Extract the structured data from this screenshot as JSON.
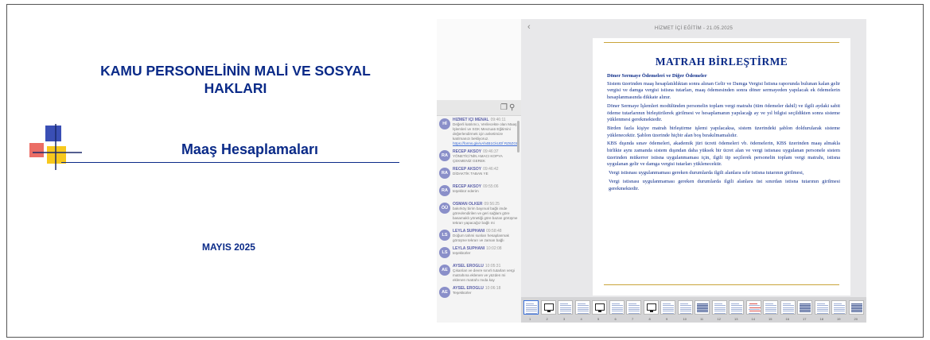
{
  "slide": {
    "title": "KAMU PERSONELİNİN  MALİ VE SOSYAL HAKLARI",
    "subtitle": "Maaş Hesaplamaları",
    "date_month": "MAYIS",
    "date_year": "2025",
    "colors": {
      "title": "#0a2a88",
      "deco_blue": "#3a4fb5",
      "deco_yellow": "#f7c81d",
      "deco_red": "#e8544a"
    }
  },
  "screenshot": {
    "header": "HİZMET İÇİ EĞİTİM - 21.05.2025",
    "back_icon": "chevron-left-icon",
    "chat": {
      "toolbar_icons": [
        "copy-icon",
        "search-icon"
      ],
      "messages": [
        {
          "initials": "Hİ",
          "name": "HİZMET İÇİ MENAL",
          "time": "09:46:11",
          "text": "Değerli katılımcı, Verilecekte olan Maaş İşlemleri ve SGK Mevzuatı Eğitimini değerlendirmek için anketimize katılmanızı bekliyoruz.",
          "link": "https://forms.gle/xAh4B1CkUDf RZ6ZG8"
        },
        {
          "initials": "RA",
          "name": "RECEP AKSOY",
          "time": "09:46:37",
          "text": "YÖNETİCİ'NİN AMACI KOPYA ÇEKMENİZ GEREK"
        },
        {
          "initials": "RA",
          "name": "RECEP AKSOY",
          "time": "09:46:42",
          "text": "DİDAKTİK TABAN YE"
        },
        {
          "initials": "RA",
          "name": "RECEP AKSOY",
          "time": "09:55:06",
          "text": "teşekkür ederim"
        },
        {
          "initials": "ÖÜ",
          "name": "OSMAN ÖLKER",
          "time": "09:56:25",
          "text": "bakırköy birim bayınıal bağlı imde görevlendirilen ve geri sağlam göre basamaklı yönetiği göre bazan görüşme tekrarı yapacağız bağlı mi"
        },
        {
          "initials": "LS",
          "name": "LEYLA SÜPHANİ",
          "time": "09:58:48",
          "text": "Doğum tahmi sunları hesaplanmak görüşme tekrarı ve zaman bağlı"
        },
        {
          "initials": "LS",
          "name": "LEYLA SÜPHANİ",
          "time": "10:02:08",
          "text": "teşekkürler"
        },
        {
          "initials": "AE",
          "name": "AYSEL EROĞLU",
          "time": "10:05:31",
          "text": "Çıkarılan ve devre sınırlı tutarları vergi matrahına eklenen ve yüzden mi eklenen matrahı mıda kay"
        },
        {
          "initials": "AE",
          "name": "AYSEL EROĞLU",
          "time": "10:06:18",
          "text": "Teşekkürler"
        }
      ]
    },
    "document": {
      "title": "MATRAH BİRLEŞTİRME",
      "section": "Döner Sermaye Ödemeleri ve Diğer Ödemeler",
      "paragraphs": [
        "Sistem üzerinden maaş hesaplatıldıktan sonra alınan Gelir ve Damga Vergisi İstisna raporunda bulunan kalan gelir vergisi ve damga vergisi istisna tutarları, maaş ödemesinden sonra döner sermayeden yapılacak ek ödemelerin hesaplanmasında dikkate alınır.",
        "Döner Sermaye İşlemleri modülünden personelin toplam vergi matrahı (tüm ödemeler dahil) ve ilgili aydaki sabit ödeme tutarlarının birleştirilerek girilmesi ve hesaplamanın yapılacağı ay ve yıl bilgisi seçildikten sonra sisteme yüklenmesi gerekmektedir.",
        "Birden fazla kişiye matrah birleştirme işlemi yapılacaksa, sistem üzerindeki şablon doldurularak sisteme yüklenecektir. Şablon üzerinde hiçbir alan boş bırakılmamalıdır.",
        "KBS dışında sınav ödemeleri, akademik jüri ücreti ödemeleri vb. ödemelerin, KBS üzerinden maaş almakla birlikte aynı zamanda sistem dışından daha yüksek bir ücret alan ve vergi istisnası uygulanan personele sistem üzerinden mükerrer istisna uygulanmaması için, ilgili tip seçilerek personelin toplam vergi matrahı, istisna uygulanan gelir ve damga vergisi tutarları yüklenecektir.",
        "Vergi istisnası uygulanmaması gereken durumlarda ilgili alanlara sıfır istisna tutarının girilmesi,",
        "Vergi istisnası uygulanmaması gereken durumlarda ilgili alanlara üst sınırdan istisna tutarının girilmesi gerekmektedir."
      ]
    },
    "thumbnails": [
      "1",
      "2",
      "3",
      "4",
      "5",
      "6",
      "7",
      "8",
      "9",
      "10",
      "11",
      "12",
      "13",
      "14",
      "15",
      "16",
      "17",
      "18",
      "19",
      "20"
    ]
  }
}
